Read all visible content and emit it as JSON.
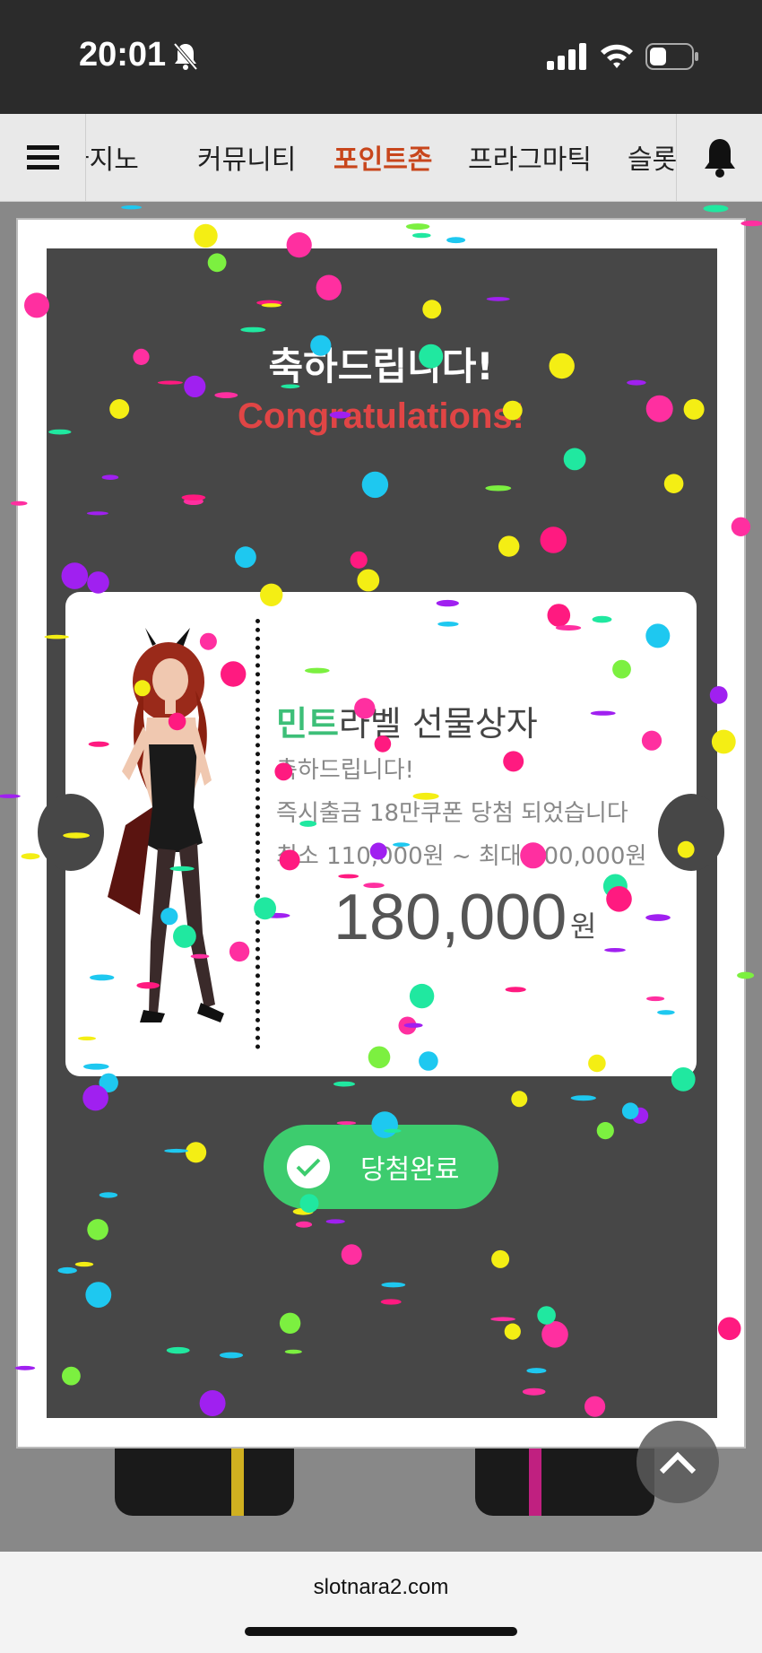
{
  "status_bar": {
    "time": "20:01"
  },
  "nav": {
    "tabs": [
      {
        "label": "카지노",
        "active": false
      },
      {
        "label": "커뮤니티",
        "active": false
      },
      {
        "label": "포인트존",
        "active": true
      },
      {
        "label": "프라그마틱",
        "active": false
      },
      {
        "label": "슬롯",
        "active": false
      }
    ]
  },
  "modal": {
    "title_ko": "축하드립니다!",
    "title_en": "Congratulations!",
    "ticket": {
      "title_highlight": "민트",
      "title_rest": "라벨 선물상자",
      "congrats": "축하드립니다!",
      "win_message": "즉시출금 18만쿠폰 당첨 되었습니다",
      "range": "최소 110,000원 ~ 최대 200,000원",
      "amount": "180,000",
      "unit": "원"
    },
    "done_label": "당첨완료"
  },
  "browser": {
    "url": "slotnara2.com"
  },
  "colors": {
    "accent_active_tab": "#c8461c",
    "mint": "#3dbf78",
    "button_green": "#3dcc6e",
    "congrats_red": "#e04545"
  },
  "icons": [
    "bell-off-icon",
    "signal-icon",
    "wifi-icon",
    "battery-icon",
    "hamburger-icon",
    "bell-icon",
    "check-icon",
    "chevron-up-icon"
  ]
}
